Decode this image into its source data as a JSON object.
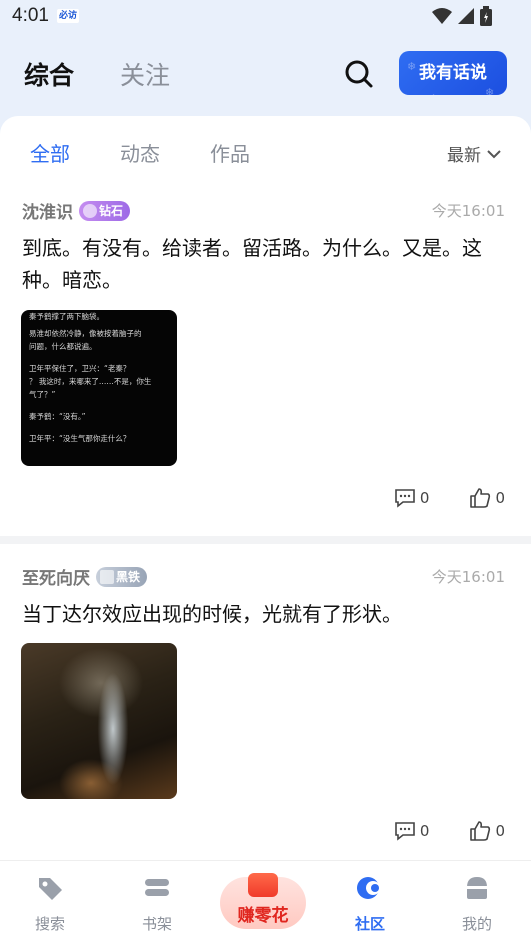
{
  "status_bar": {
    "time": "4:01",
    "app_badge": "必访"
  },
  "header": {
    "tabs": [
      {
        "label": "综合",
        "active": true
      },
      {
        "label": "关注",
        "active": false
      }
    ],
    "post_button": "我有话说"
  },
  "subtabs": {
    "items": [
      {
        "label": "全部",
        "active": true
      },
      {
        "label": "动态",
        "active": false
      },
      {
        "label": "作品",
        "active": false
      }
    ],
    "sort_label": "最新"
  },
  "posts": [
    {
      "author": "沈淮识",
      "badge": "钻石",
      "time": "今天16:01",
      "text": "到底。有没有。给读者。留活路。为什么。又是。这种。暗恋。",
      "image_lines": [
        "秦予鹤撑了两下脑袋。",
        "易淮却依然冷静，像被按着脑子的",
        "问题，什么都说遍。",
        "卫年平保住了，卫兴：“老秦？",
        "？ 我这时，来哪来了……不是，你生",
        "气了？”",
        "秦予鹤：“没有。”",
        "卫年平：“没生气那你走什么？"
      ],
      "comments": "0",
      "likes": "0"
    },
    {
      "author": "至死向厌",
      "badge": "黑铁",
      "time": "今天16:01",
      "text": "当丁达尔效应出现的时候，光就有了形状。",
      "comments": "0",
      "likes": "0"
    }
  ],
  "bottom_nav": {
    "items": [
      {
        "label": "搜索",
        "icon": "tag-icon"
      },
      {
        "label": "书架",
        "icon": "bookshelf-icon"
      },
      {
        "label": "赚零花",
        "icon": "red-envelope-icon"
      },
      {
        "label": "社区",
        "icon": "community-icon",
        "active": true
      },
      {
        "label": "我的",
        "icon": "profile-icon"
      }
    ]
  },
  "colors": {
    "accent": "#2f6df2",
    "earn": "#e0261f"
  }
}
